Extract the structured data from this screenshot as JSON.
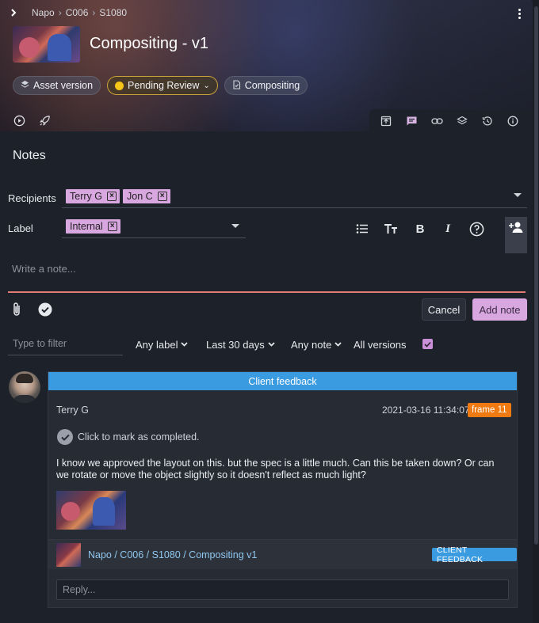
{
  "breadcrumb": [
    "Napo",
    "C006",
    "S1080"
  ],
  "header": {
    "title": "Compositing - v1",
    "chips": {
      "asset_version": "Asset version",
      "status": "Pending Review",
      "task": "Compositing"
    }
  },
  "notes": {
    "title": "Notes",
    "recipients_label": "Recipients",
    "recipients": [
      "Terry G",
      "Jon C"
    ],
    "label_label": "Label",
    "label_value": "Internal",
    "note_placeholder": "Write a note...",
    "cancel_label": "Cancel",
    "add_label": "Add note"
  },
  "filters": {
    "placeholder": "Type to filter",
    "any_label": "Any label",
    "date_range": "Last 30 days",
    "any_note": "Any note",
    "all_versions": "All versions",
    "all_versions_checked": true
  },
  "note_card": {
    "label_header": "Client feedback",
    "author": "Terry G",
    "timestamp": "2021-03-16 11:34:07",
    "frame": "frame 11",
    "complete_hint": "Click to mark as completed.",
    "body": "I know we approved the layout on this. but the spec is a little much. Can this be taken down? Or can we rotate or move the object slightly so it doesn't reflect as much light?",
    "link_text": "Napo / C006 / S1080 / Compositing v1",
    "link_badge": "CLIENT FEEDBACK",
    "reply_placeholder": "Reply..."
  },
  "colors": {
    "accent": "#d9a7e0",
    "client_feedback": "#3b9be0",
    "frame_badge": "#f07a12",
    "pending": "#f5c518",
    "input_underline": "#e07c72"
  }
}
